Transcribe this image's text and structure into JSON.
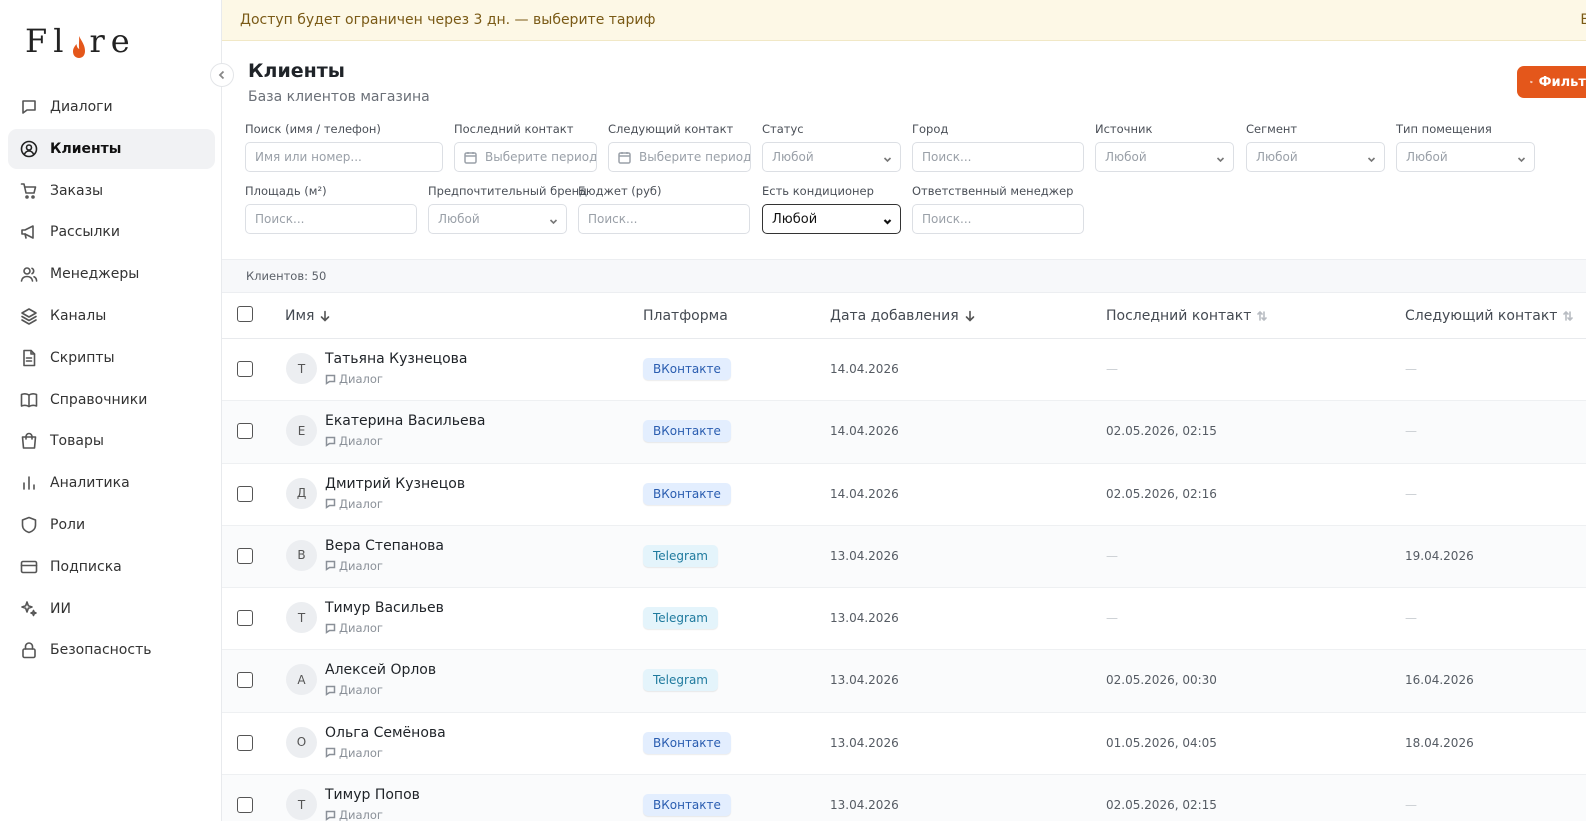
{
  "brand": {
    "logo_left": "Fl",
    "logo_right": "re",
    "accent": "#e4571b"
  },
  "sidebar": {
    "items": [
      {
        "label": "Диалоги",
        "icon": "chat-icon",
        "active": false
      },
      {
        "label": "Клиенты",
        "icon": "user-circle-icon",
        "active": true
      },
      {
        "label": "Заказы",
        "icon": "cart-icon",
        "active": false
      },
      {
        "label": "Рассылки",
        "icon": "megaphone-icon",
        "active": false
      },
      {
        "label": "Менеджеры",
        "icon": "users-icon",
        "active": false
      },
      {
        "label": "Каналы",
        "icon": "layers-icon",
        "active": false
      },
      {
        "label": "Скрипты",
        "icon": "document-icon",
        "active": false
      },
      {
        "label": "Справочники",
        "icon": "book-icon",
        "active": false
      },
      {
        "label": "Товары",
        "icon": "bag-icon",
        "active": false
      },
      {
        "label": "Аналитика",
        "icon": "bar-chart-icon",
        "active": false
      },
      {
        "label": "Роли",
        "icon": "shield-icon",
        "active": false
      },
      {
        "label": "Подписка",
        "icon": "card-icon",
        "active": false
      },
      {
        "label": "ИИ",
        "icon": "sparkles-icon",
        "active": false
      },
      {
        "label": "Безопасность",
        "icon": "lock-icon",
        "active": false
      }
    ]
  },
  "banner": {
    "text": "Доступ будет ограничен через 3 дн. — выберите тариф",
    "trailing": "В"
  },
  "page": {
    "title": "Клиенты",
    "subtitle": "База клиентов магазина",
    "filter_button": "Фильтры"
  },
  "filters": {
    "search": {
      "label": "Поиск (имя / телефон)",
      "placeholder": "Имя или номер..."
    },
    "last_contact": {
      "label": "Последний контакт",
      "placeholder": "Выберите период"
    },
    "next_contact": {
      "label": "Следующий контакт",
      "placeholder": "Выберите период"
    },
    "status": {
      "label": "Статус",
      "value": "Любой"
    },
    "city": {
      "label": "Город",
      "placeholder": "Поиск..."
    },
    "source": {
      "label": "Источник",
      "value": "Любой"
    },
    "segment": {
      "label": "Сегмент",
      "value": "Любой"
    },
    "room_type": {
      "label": "Тип помещения",
      "value": "Любой"
    },
    "area": {
      "label": "Площадь (м²)",
      "placeholder": "Поиск..."
    },
    "brand": {
      "label": "Предпочтительный бренд",
      "value": "Любой"
    },
    "budget": {
      "label": "Бюджет (руб)",
      "placeholder": "Поиск..."
    },
    "ac": {
      "label": "Есть кондиционер",
      "value": "Любой"
    },
    "manager": {
      "label": "Ответственный менеджер",
      "placeholder": "Поиск..."
    }
  },
  "count_text": "Клиентов: 50",
  "table": {
    "columns": {
      "name": "Имя",
      "platform": "Платформа",
      "date_added": "Дата добавления",
      "last_contact": "Последний контакт",
      "next_contact": "Следующий контакт"
    },
    "sub_label": "Диалог",
    "rows": [
      {
        "initial": "Т",
        "name": "Татьяна Кузнецова",
        "platform": "ВКонтакте",
        "ptype": "vk",
        "added": "14.04.2026",
        "last": "—",
        "next": "—"
      },
      {
        "initial": "Е",
        "name": "Екатерина Васильева",
        "platform": "ВКонтакте",
        "ptype": "vk",
        "added": "14.04.2026",
        "last": "02.05.2026, 02:15",
        "next": "—"
      },
      {
        "initial": "Д",
        "name": "Дмитрий Кузнецов",
        "platform": "ВКонтакте",
        "ptype": "vk",
        "added": "14.04.2026",
        "last": "02.05.2026, 02:16",
        "next": "—"
      },
      {
        "initial": "В",
        "name": "Вера Степанова",
        "platform": "Telegram",
        "ptype": "tg",
        "added": "13.04.2026",
        "last": "—",
        "next": "19.04.2026"
      },
      {
        "initial": "Т",
        "name": "Тимур Васильев",
        "platform": "Telegram",
        "ptype": "tg",
        "added": "13.04.2026",
        "last": "—",
        "next": "—"
      },
      {
        "initial": "А",
        "name": "Алексей Орлов",
        "platform": "Telegram",
        "ptype": "tg",
        "added": "13.04.2026",
        "last": "02.05.2026, 00:30",
        "next": "16.04.2026"
      },
      {
        "initial": "О",
        "name": "Ольга Семёнова",
        "platform": "ВКонтакте",
        "ptype": "vk",
        "added": "13.04.2026",
        "last": "01.05.2026, 04:05",
        "next": "18.04.2026"
      },
      {
        "initial": "Т",
        "name": "Тимур Попов",
        "platform": "ВКонтакте",
        "ptype": "vk",
        "added": "13.04.2026",
        "last": "02.05.2026, 02:15",
        "next": "—"
      }
    ]
  }
}
